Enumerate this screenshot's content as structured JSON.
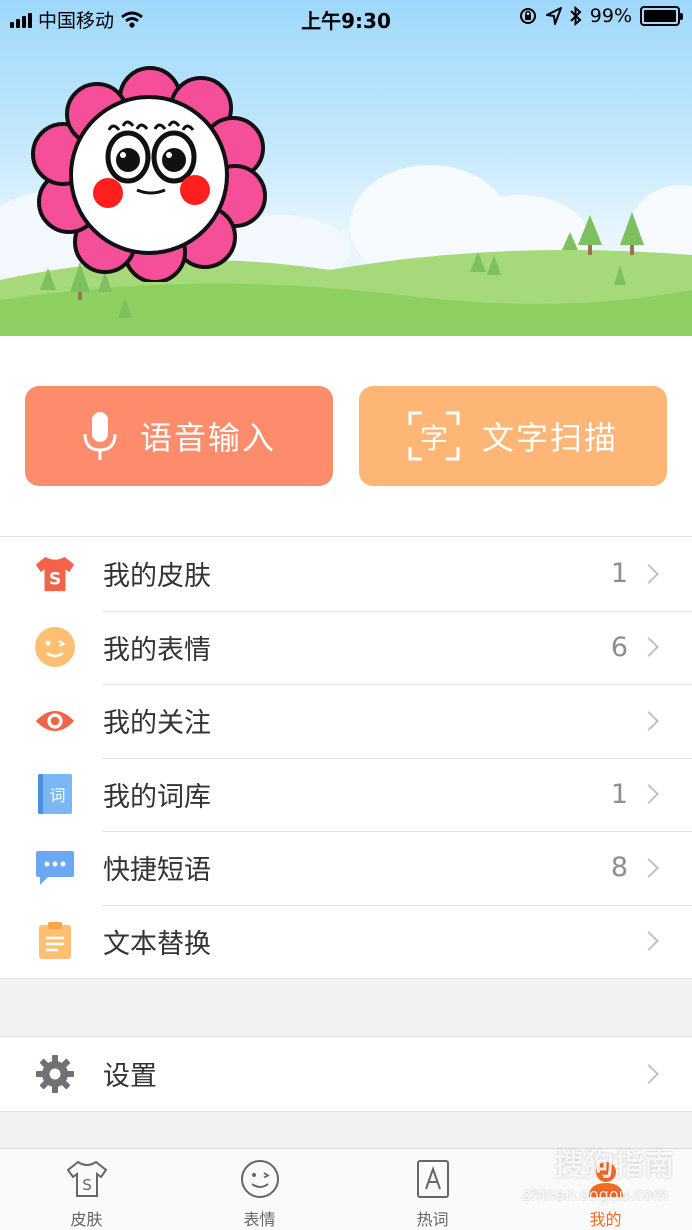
{
  "status_bar": {
    "carrier": "中国移动",
    "time": "上午9:30",
    "battery": "99%",
    "battery_level": 0.99
  },
  "actions": {
    "voice_input": "语音输入",
    "text_scan": "文字扫描",
    "scan_glyph": "字"
  },
  "menu": [
    {
      "label": "我的皮肤",
      "count": "1",
      "icon": "tshirt-icon"
    },
    {
      "label": "我的表情",
      "count": "6",
      "icon": "smiley-icon"
    },
    {
      "label": "我的关注",
      "count": "",
      "icon": "eye-icon"
    },
    {
      "label": "我的词库",
      "count": "1",
      "icon": "book-icon",
      "glyph": "词"
    },
    {
      "label": "快捷短语",
      "count": "8",
      "icon": "chat-bubble-icon"
    },
    {
      "label": "文本替换",
      "count": "",
      "icon": "clipboard-icon"
    }
  ],
  "settings": {
    "label": "设置",
    "icon": "gear-icon"
  },
  "tabs": [
    {
      "label": "皮肤",
      "icon": "tshirt-icon",
      "active": false
    },
    {
      "label": "表情",
      "icon": "smiley-icon",
      "active": false
    },
    {
      "label": "热词",
      "icon": "letter-a-icon",
      "active": false
    },
    {
      "label": "我的",
      "icon": "person-icon",
      "active": true
    }
  ],
  "watermark": {
    "text": "搜狗指南",
    "sub": "zhinan.sogou.com"
  },
  "colors": {
    "voice_button": "#fd8c6c",
    "scan_button": "#fdb676",
    "active_tab": "#f26a25"
  }
}
